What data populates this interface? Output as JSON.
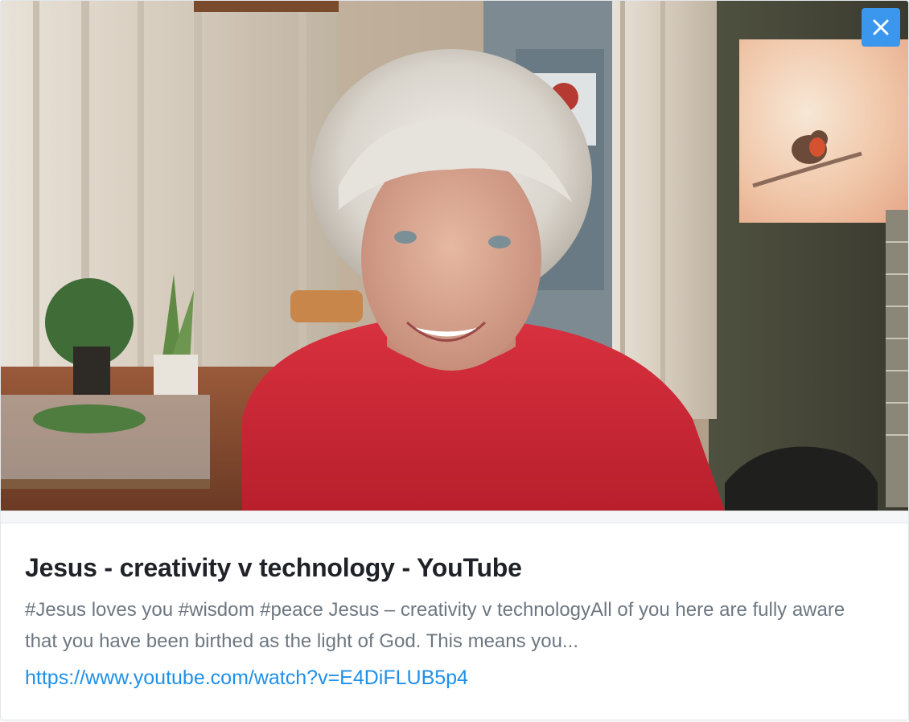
{
  "card": {
    "title": "Jesus - creativity v technology - YouTube",
    "description": "#Jesus loves you #wisdom #peace Jesus – creativity v technologyAll of you here are fully aware that you have been birthed as the light of God. This means you...",
    "url": "https://www.youtube.com/watch?v=E4DiFLUB5p4"
  },
  "close_button": {
    "icon": "close-icon",
    "color": "#3b97ee"
  },
  "colors": {
    "title": "#1f2328",
    "description": "#6d7781",
    "link": "#1e90ea"
  }
}
